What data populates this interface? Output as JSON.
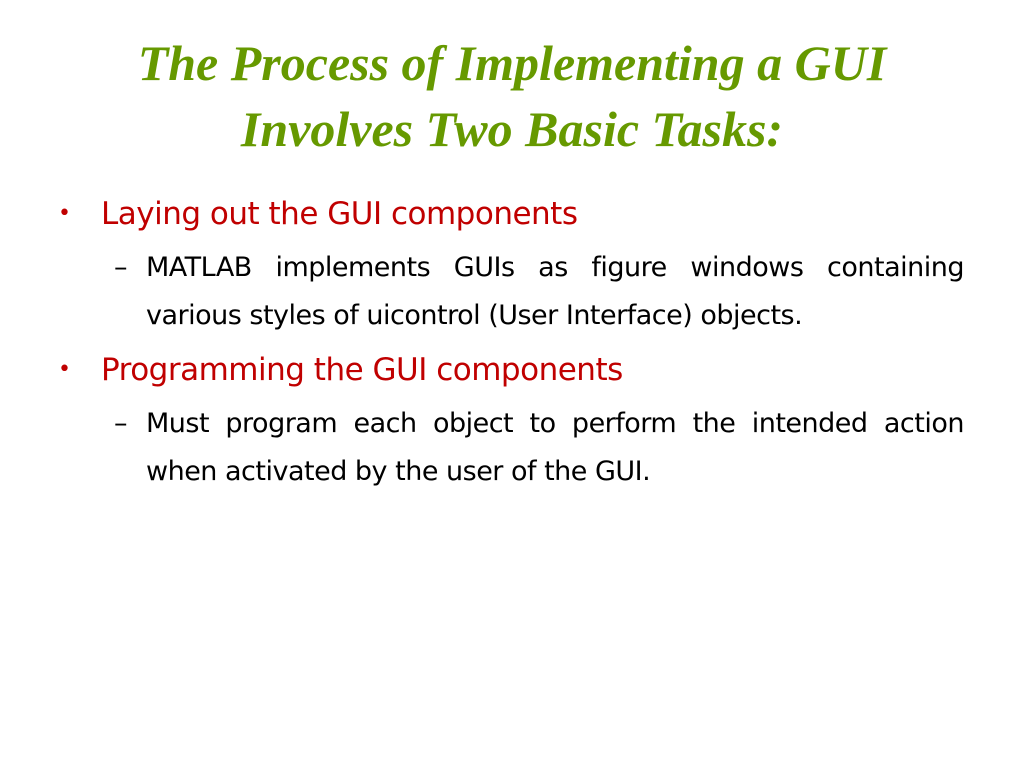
{
  "slide": {
    "title_lines": [
      "The Process of Implementing a GUI",
      "Involves Two Basic Tasks:"
    ],
    "colors": {
      "title": "#669900",
      "level1": "#c00000",
      "level2": "#000000",
      "background": "#ffffff"
    },
    "bullets": [
      {
        "marker": "•",
        "text": "Laying out the GUI components",
        "sub": {
          "marker": "–",
          "text": "MATLAB implements GUIs as figure windows containing various styles of uicontrol (User Interface) objects."
        }
      },
      {
        "marker": "•",
        "text": "Programming the GUI components",
        "sub": {
          "marker": "–",
          "text": "Must program each object to perform the intended action when activated by the user of the GUI."
        }
      }
    ]
  }
}
